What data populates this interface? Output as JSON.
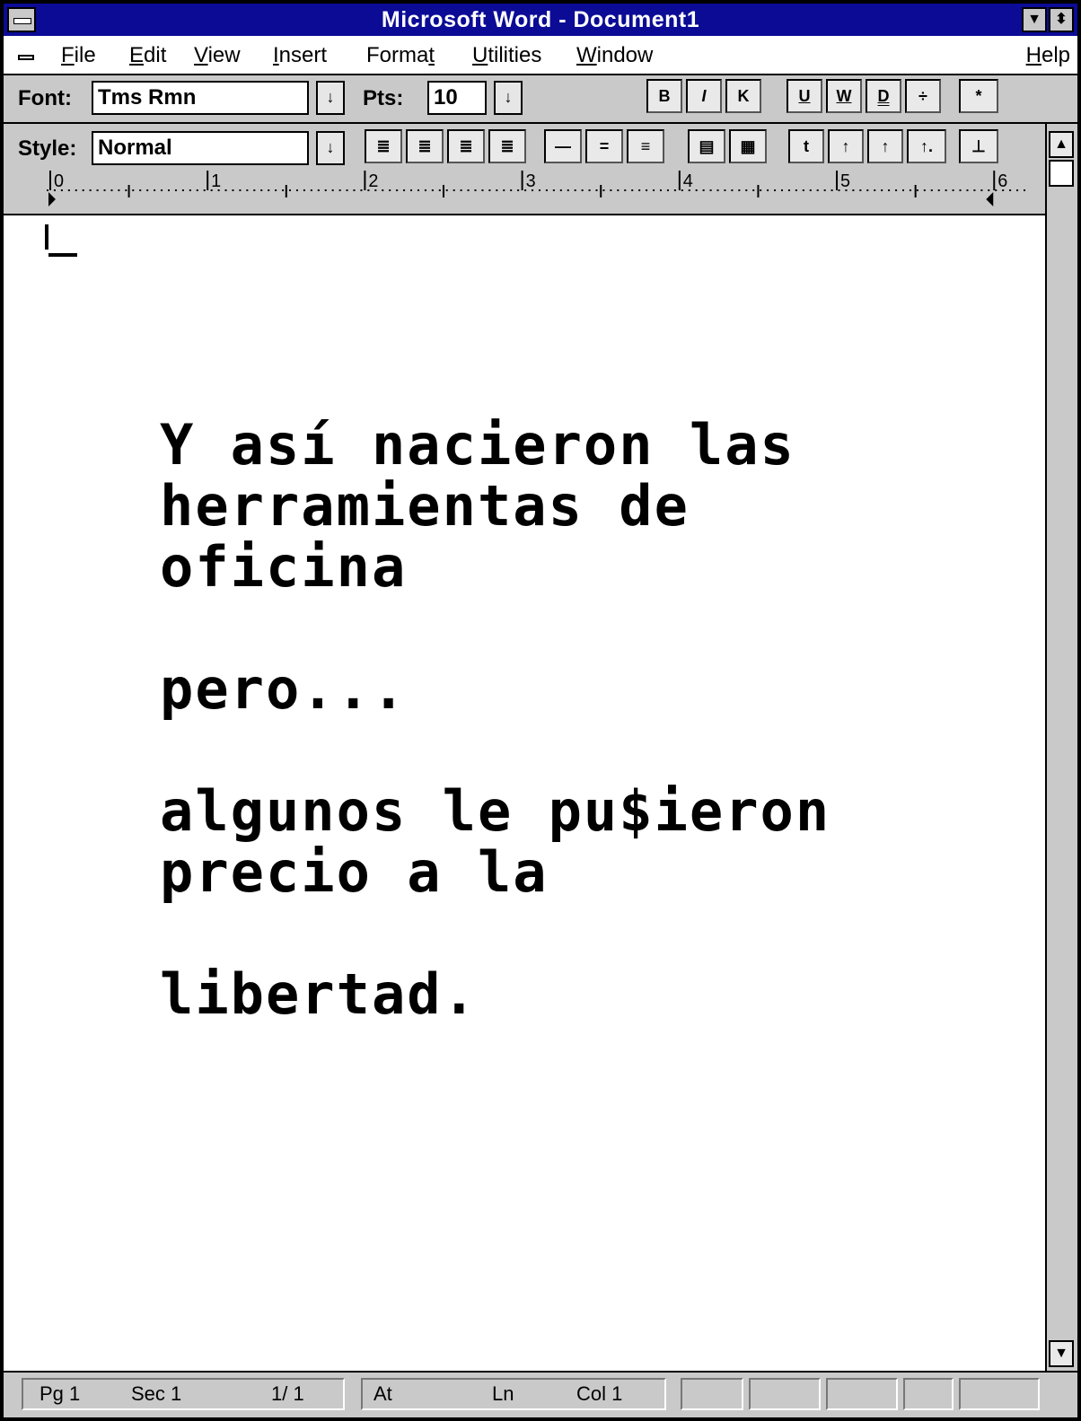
{
  "window": {
    "title": "Microsoft Word - Document1",
    "minimize_glyph": "▼",
    "restore_glyph": "⬍"
  },
  "menu": {
    "items": [
      {
        "hotkey": "F",
        "rest": "ile"
      },
      {
        "hotkey": "E",
        "rest": "dit"
      },
      {
        "hotkey": "V",
        "rest": "iew"
      },
      {
        "hotkey": "I",
        "rest": "nsert"
      },
      {
        "pre": "Forma",
        "hotkey": "t",
        "rest": ""
      },
      {
        "hotkey": "U",
        "rest": "tilities"
      },
      {
        "hotkey": "W",
        "rest": "indow"
      },
      {
        "hotkey": "H",
        "rest": "elp"
      }
    ]
  },
  "ribbon": {
    "font_label": "Font:",
    "font_value": "Tms Rmn",
    "pts_label": "Pts:",
    "pts_value": "10",
    "dropdown_glyph": "↓",
    "bold": "B",
    "italic": "I",
    "small_caps": "K",
    "underline": "U",
    "word_underline": "W",
    "double_underline": "D",
    "super_sub": "÷",
    "show_all": "*"
  },
  "ruler": {
    "style_label": "Style:",
    "style_value": "Normal",
    "marks": [
      "0",
      "1",
      "2",
      "3",
      "4",
      "5",
      "6"
    ],
    "align_glyphs": [
      "≣",
      "≣",
      "≣",
      "≣"
    ],
    "spacing_glyphs": [
      "—",
      "=",
      "≡"
    ],
    "para_space_glyphs": [
      "▤",
      "▦"
    ],
    "tab_glyphs": [
      "t",
      "↑",
      "↑",
      "↑."
    ],
    "ruler_toggle": "⊥"
  },
  "document": {
    "lines": [
      "Y así nacieron las",
      "herramientas de",
      "oficina",
      "",
      "pero...",
      "",
      "algunos le pu$ieron",
      "precio a la",
      "",
      "libertad."
    ]
  },
  "status": {
    "pg": "Pg 1",
    "sec": "Sec 1",
    "pages": "1/ 1",
    "at": "At",
    "ln": "Ln",
    "col": "Col 1"
  },
  "scrollbar": {
    "up_glyph": "▲",
    "down_glyph": "▼"
  }
}
